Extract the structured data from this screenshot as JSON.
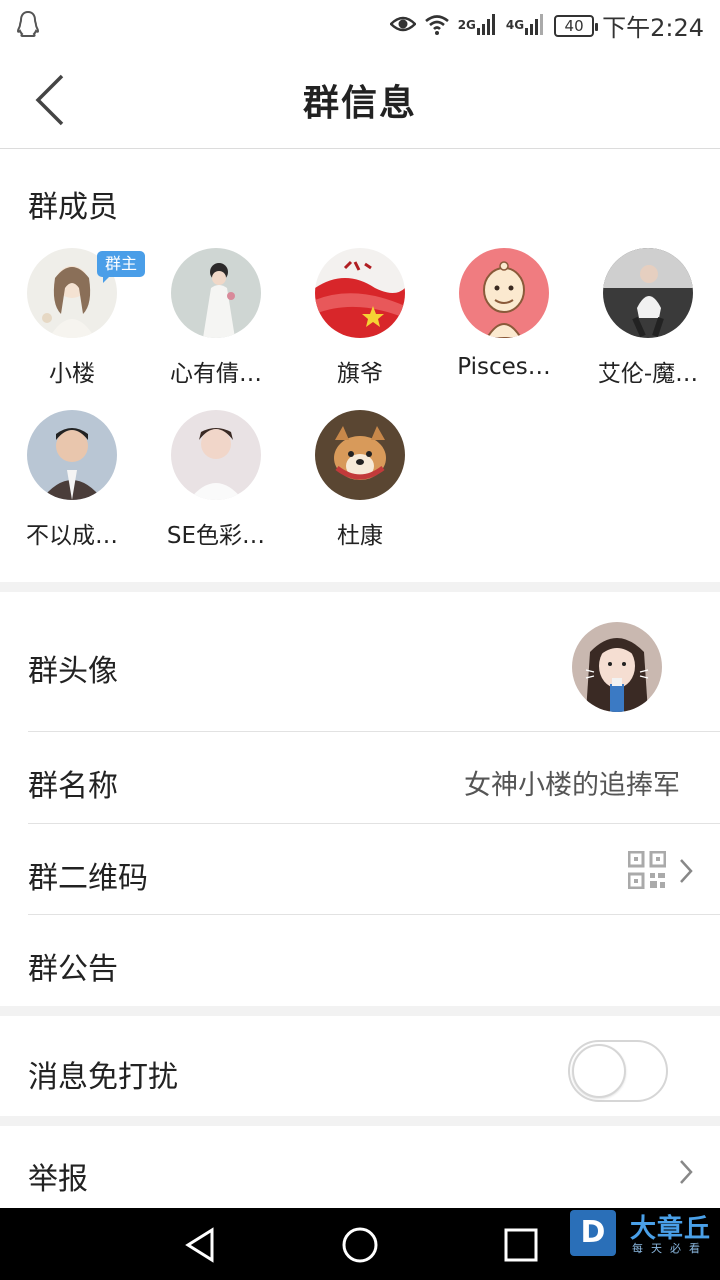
{
  "status_bar": {
    "network_2g": "2G",
    "network_4g": "4G",
    "battery": "40",
    "time": "下午2:24"
  },
  "header": {
    "title": "群信息"
  },
  "members": {
    "section_title": "群成员",
    "owner_badge": "群主",
    "list": [
      {
        "name": "小楼",
        "is_owner": true
      },
      {
        "name": "心有倩…",
        "is_owner": false
      },
      {
        "name": "旗爷",
        "is_owner": false
      },
      {
        "name": "Pisces…",
        "is_owner": false
      },
      {
        "name": "艾伦-魔…",
        "is_owner": false
      },
      {
        "name": "不以成…",
        "is_owner": false
      },
      {
        "name": "SE色彩…",
        "is_owner": false
      },
      {
        "name": "杜康",
        "is_owner": false
      }
    ]
  },
  "settings": {
    "group_avatar_label": "群头像",
    "group_name_label": "群名称",
    "group_name_value": "女神小楼的追捧军",
    "qr_label": "群二维码",
    "notice_label": "群公告",
    "mute_label": "消息免打扰",
    "mute_enabled": false,
    "report_label": "举报"
  },
  "watermark": {
    "logo": "D",
    "name": "大章丘",
    "slogan": "每天必看"
  }
}
